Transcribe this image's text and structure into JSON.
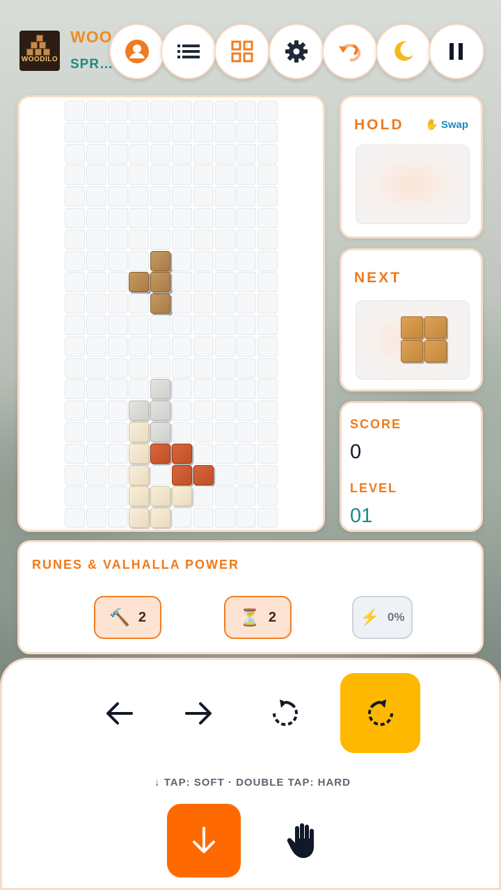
{
  "header": {
    "logo_text": "WOODILO",
    "title": "WOO",
    "subtitle": "SPR…"
  },
  "top_buttons": [
    {
      "name": "profile",
      "icon": "user-icon"
    },
    {
      "name": "leaderboard",
      "icon": "list-icon"
    },
    {
      "name": "menu-grid",
      "icon": "grid-icon"
    },
    {
      "name": "settings",
      "icon": "gear-icon"
    },
    {
      "name": "undo",
      "icon": "undo-icon"
    },
    {
      "name": "theme",
      "icon": "moon-icon"
    },
    {
      "name": "pause",
      "icon": "pause-icon"
    }
  ],
  "hold": {
    "title": "HOLD",
    "swap_icon": "✋",
    "swap_label": "Swap"
  },
  "next": {
    "title": "NEXT",
    "piece": "O"
  },
  "stats": {
    "score_label": "SCORE",
    "score_value": "0",
    "level_label": "LEVEL",
    "level_value": "01"
  },
  "runes": {
    "title": "RUNES & VALHALLA POWER",
    "items": [
      {
        "icon": "🔨",
        "count": "2"
      },
      {
        "icon": "⏳",
        "count": "2"
      },
      {
        "icon": "⚡",
        "count": "0%"
      }
    ]
  },
  "controls": {
    "hint": "↓ TAP: SOFT · DOUBLE TAP: HARD"
  },
  "colors": {
    "accent": "#EF7A1A",
    "teal": "#1F8A84",
    "rotate_active": "#FFB800",
    "drop": "#FF6A00"
  }
}
